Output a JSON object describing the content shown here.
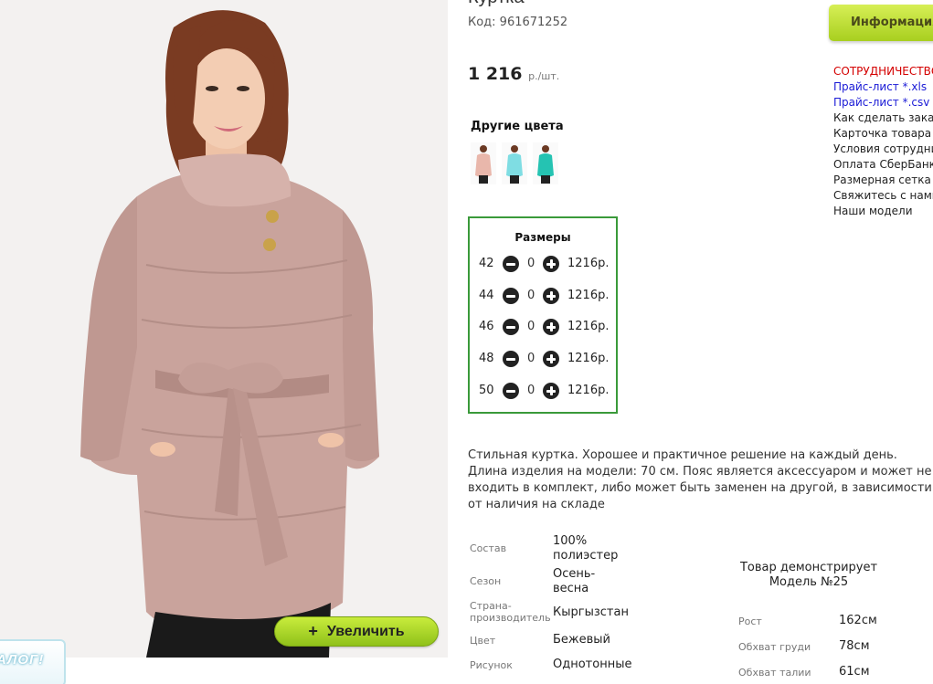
{
  "product": {
    "title_fragment": "Куртка",
    "code": "Код: 961671252",
    "price": "1 216",
    "price_unit": "р./шт."
  },
  "other_colors": {
    "title": "Другие цвета",
    "items": [
      {
        "color": "#e9b7ab"
      },
      {
        "color": "#7fdde3"
      },
      {
        "color": "#25c3b2"
      }
    ]
  },
  "sizes": {
    "title": "Размеры",
    "rows": [
      {
        "size": "42",
        "qty": "0",
        "price": "1216р."
      },
      {
        "size": "44",
        "qty": "0",
        "price": "1216р."
      },
      {
        "size": "46",
        "qty": "0",
        "price": "1216р."
      },
      {
        "size": "48",
        "qty": "0",
        "price": "1216р."
      },
      {
        "size": "50",
        "qty": "0",
        "price": "1216р."
      }
    ]
  },
  "description": "Стильная куртка. Хорошее и практичное решение на каждый день. Длина изделия на модели: 70 см. Пояс является аксессуаром и может не входить в комплект, либо может быть заменен на другой, в зависимости от наличия на складе",
  "specs": [
    {
      "label": "Состав",
      "value": "100% полиэстер"
    },
    {
      "label": "Сезон",
      "value": "Осень-весна"
    },
    {
      "label": "Страна-производитель",
      "value": "Кыргызстан"
    },
    {
      "label": "Цвет",
      "value": "Бежевый"
    },
    {
      "label": "Рисунок",
      "value": "Однотонные"
    }
  ],
  "model": {
    "title": "Товар демонстрирует Модель №25",
    "rows": [
      {
        "label": "Рост",
        "value": "162см"
      },
      {
        "label": "Обхват груди",
        "value": "78см"
      },
      {
        "label": "Обхват талии",
        "value": "61см"
      }
    ]
  },
  "zoom_button": {
    "label": "Увеличить",
    "icon": "plus-icon"
  },
  "catalog_tab": {
    "label": "АЛОГ!"
  },
  "info_tab": {
    "label": "Информация"
  },
  "right_links": {
    "coop": "СОТРУДНИЧЕСТВО",
    "price_xls": "Прайс-лист *.xls",
    "price_csv": "Прайс-лист *.csv",
    "how_to_order": "Как сделать заказ",
    "product_card": "Карточка товара",
    "terms": "Условия сотрудничества",
    "sberbank": "Оплата СберБанк",
    "size_chart": "Размерная сетка",
    "contact": "Свяжитесь с нами",
    "our_models": "Наши модели"
  },
  "colors": {
    "accent_green": "#a8cf1f",
    "sizes_border": "#3a9a3a",
    "link_red": "#d40000",
    "link_blue": "#1a1ad6",
    "jacket": "#c9a39c"
  }
}
